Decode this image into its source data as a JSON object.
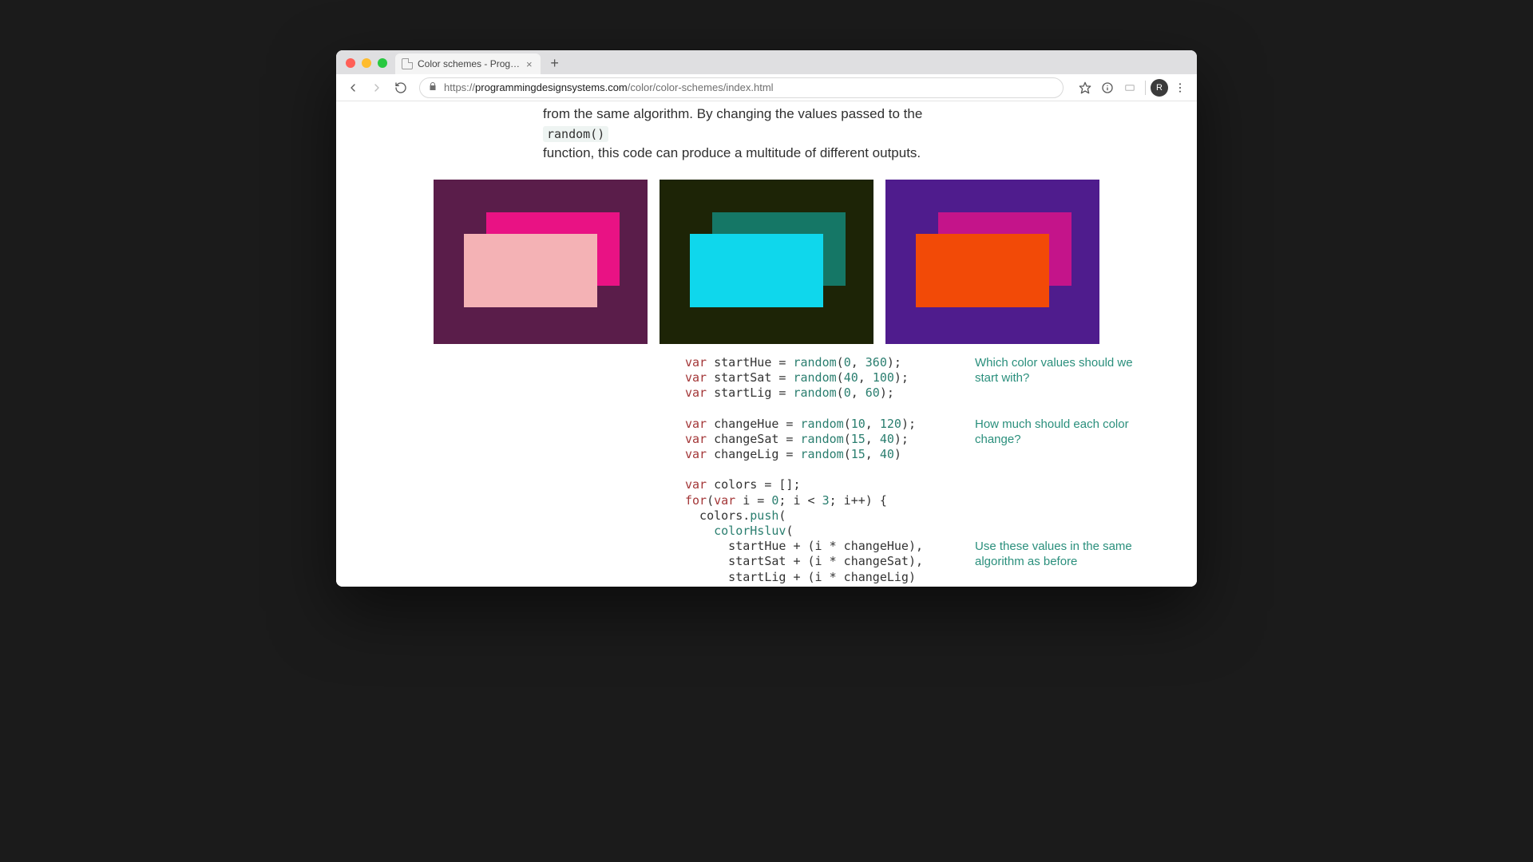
{
  "browser": {
    "tab_title": "Color schemes - Programming",
    "url_host": "programmingdesignsystems.com",
    "url_path": "/color/color-schemes/index.html",
    "url_scheme": "https://",
    "avatar_initial": "R"
  },
  "prose": {
    "line1_a": "from the same algorithm. By changing the values passed to the ",
    "inline_code": "random()",
    "line2": "function, this code can produce a multitude of different outputs."
  },
  "swatches": [
    {
      "bg": "#5a1d4a",
      "r2": "#e91284",
      "r3": "#f4b2b5"
    },
    {
      "bg": "#1d2406",
      "r2": "#157766",
      "r3": "#0fd7ec"
    },
    {
      "bg": "#4f1c8d",
      "r2": "#c4148a",
      "r3": "#f24a07"
    }
  ],
  "annotations": {
    "a1": "Which color values should we start with?",
    "a2": "How much should each color change?",
    "a3": "Use these values in the same algorithm as before"
  },
  "code": {
    "l01a": "var",
    "l01b": " startHue = ",
    "l01c": "random",
    "l01d": "(",
    "l01e": "0",
    "l01f": ", ",
    "l01g": "360",
    "l01h": ");",
    "l02a": "var",
    "l02b": " startSat = ",
    "l02c": "random",
    "l02d": "(",
    "l02e": "40",
    "l02f": ", ",
    "l02g": "100",
    "l02h": ");",
    "l03a": "var",
    "l03b": " startLig = ",
    "l03c": "random",
    "l03d": "(",
    "l03e": "0",
    "l03f": ", ",
    "l03g": "60",
    "l03h": ");",
    "l05a": "var",
    "l05b": " changeHue = ",
    "l05c": "random",
    "l05d": "(",
    "l05e": "10",
    "l05f": ", ",
    "l05g": "120",
    "l05h": ");",
    "l06a": "var",
    "l06b": " changeSat = ",
    "l06c": "random",
    "l06d": "(",
    "l06e": "15",
    "l06f": ", ",
    "l06g": "40",
    "l06h": ");",
    "l07a": "var",
    "l07b": " changeLig = ",
    "l07c": "random",
    "l07d": "(",
    "l07e": "15",
    "l07f": ", ",
    "l07g": "40",
    "l07h": ")",
    "l09a": "var",
    "l09b": " colors = [];",
    "l10a": "for",
    "l10b": "(",
    "l10c": "var",
    "l10d": " i = ",
    "l10e": "0",
    "l10f": "; i < ",
    "l10g": "3",
    "l10h": "; i++) {",
    "l11a": "  colors.",
    "l11b": "push",
    "l11c": "(",
    "l12a": "    ",
    "l12b": "colorHsluv",
    "l12c": "(",
    "l13": "      startHue + (i * changeHue),",
    "l14": "      startSat + (i * changeSat),",
    "l15": "      startLig + (i * changeLig)",
    "l16": "    )",
    "l17": "  )",
    "l18": "}"
  }
}
